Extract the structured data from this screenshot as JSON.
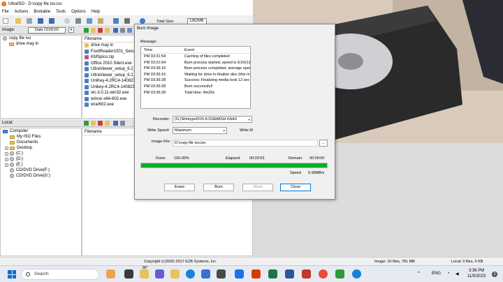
{
  "window": {
    "title": "UltraISO - D:\\copy file iso.iso",
    "menu": [
      "File",
      "Actions",
      "Bootable",
      "Tools",
      "Options",
      "Help"
    ],
    "total_size_label": "Total Size:",
    "total_size_value": "1362MB"
  },
  "image_pane": {
    "label": "Image:",
    "type_value": "Data CD/DVD",
    "tree": [
      "copy file iso",
      "drive may in"
    ],
    "column": "Filename",
    "files": [
      {
        "name": "drive may in",
        "kind": "folder"
      },
      {
        "name": "FoxitReader1001_Setup_",
        "kind": "exe"
      },
      {
        "name": "KMSpico.zip",
        "kind": "zip"
      },
      {
        "name": "Office 2010 Silent.exe",
        "kind": "exe"
      },
      {
        "name": "UltraViewer_setup_6.2_v",
        "kind": "exe"
      },
      {
        "name": "UltraViewer_setup_6.2_v",
        "kind": "exe"
      },
      {
        "name": "UniKey-4.2RC4-140823-S",
        "kind": "exe"
      },
      {
        "name": "Unikey-4.2RC4-140823-S",
        "kind": "exe"
      },
      {
        "name": "vlc-3.0.11-win32.exe",
        "kind": "exe"
      },
      {
        "name": "winrar-x64-602.exe",
        "kind": "exe"
      },
      {
        "name": "wrar602.exe",
        "kind": "exe"
      }
    ]
  },
  "local_pane": {
    "label": "Local:",
    "column": "Filename",
    "tree": [
      {
        "name": "Computer",
        "kind": "pc"
      },
      {
        "name": "My ISO Files",
        "kind": "folder"
      },
      {
        "name": "Documents",
        "kind": "folder"
      },
      {
        "name": "Desktop",
        "kind": "folder"
      },
      {
        "name": "(C:)",
        "kind": "disc"
      },
      {
        "name": "(D:)",
        "kind": "disc"
      },
      {
        "name": "(E:)",
        "kind": "disc"
      },
      {
        "name": "CD/DVD Drive(F:)",
        "kind": "disc"
      },
      {
        "name": "CD/DVD Drive(G:)",
        "kind": "disc"
      }
    ]
  },
  "status": {
    "copyright": "Copyright (c)2002-2017 EZB Systems, Inc.",
    "image_info": "Image: 10 files, 781 MB",
    "local_info": "Local: 0 files, 0 KB"
  },
  "dialog": {
    "title": "Burn Image",
    "message_label": "Message:",
    "col_time": "Time",
    "col_event": "Event",
    "messages": [
      {
        "time": "PM 03:31:54",
        "event": "Caching of files completed"
      },
      {
        "time": "PM 03:31:54",
        "event": "Burn process started, speed is 8.0X(11"
      },
      {
        "time": "PM 03:36:16",
        "event": "Burn process completed, average spee"
      },
      {
        "time": "PM 03:36:16",
        "event": "Waiting for drive to finalize disc (this m"
      },
      {
        "time": "PM 03:36:28",
        "event": "Success: Finalizing media took 12 sec"
      },
      {
        "time": "PM 03:36:28",
        "event": "Burn successful!"
      },
      {
        "time": "PM 03:36:28",
        "event": "Total time: 4m33s"
      }
    ],
    "recorder_label": "Recorder:",
    "recorder_value": "(G:)SlimtypeDVD A  DS8A8SH  KAA3",
    "write_speed_label": "Write Speed:",
    "write_speed_value": "Maximum",
    "write_m_label": "Write M",
    "image_file_label": "Image File:",
    "image_file_value": "D:\\copy file iso.iso",
    "done_label": "Done:",
    "done_value": "100.00%",
    "elapsed_label": "Elapsed:",
    "elapsed_value": "00:03:53",
    "remain_label": "Remain:",
    "remain_value": "00:00:00",
    "speed_label": "Speed",
    "speed_value": "5.99MB/s",
    "progress": 1.0,
    "buttons": {
      "erase": "Erase",
      "burn": "Burn",
      "abort": "Abort",
      "close": "Close"
    }
  },
  "taskbar": {
    "search_placeholder": "Search",
    "weather_badge": "86°",
    "lang": "ENG",
    "time": "3:36 PM",
    "date": "11/5/2023",
    "notif_count": "3"
  },
  "colors": {
    "progress_green": "#06b025",
    "start_blue": "#0a6fd6",
    "folder_yellow": "#e8c25a"
  }
}
